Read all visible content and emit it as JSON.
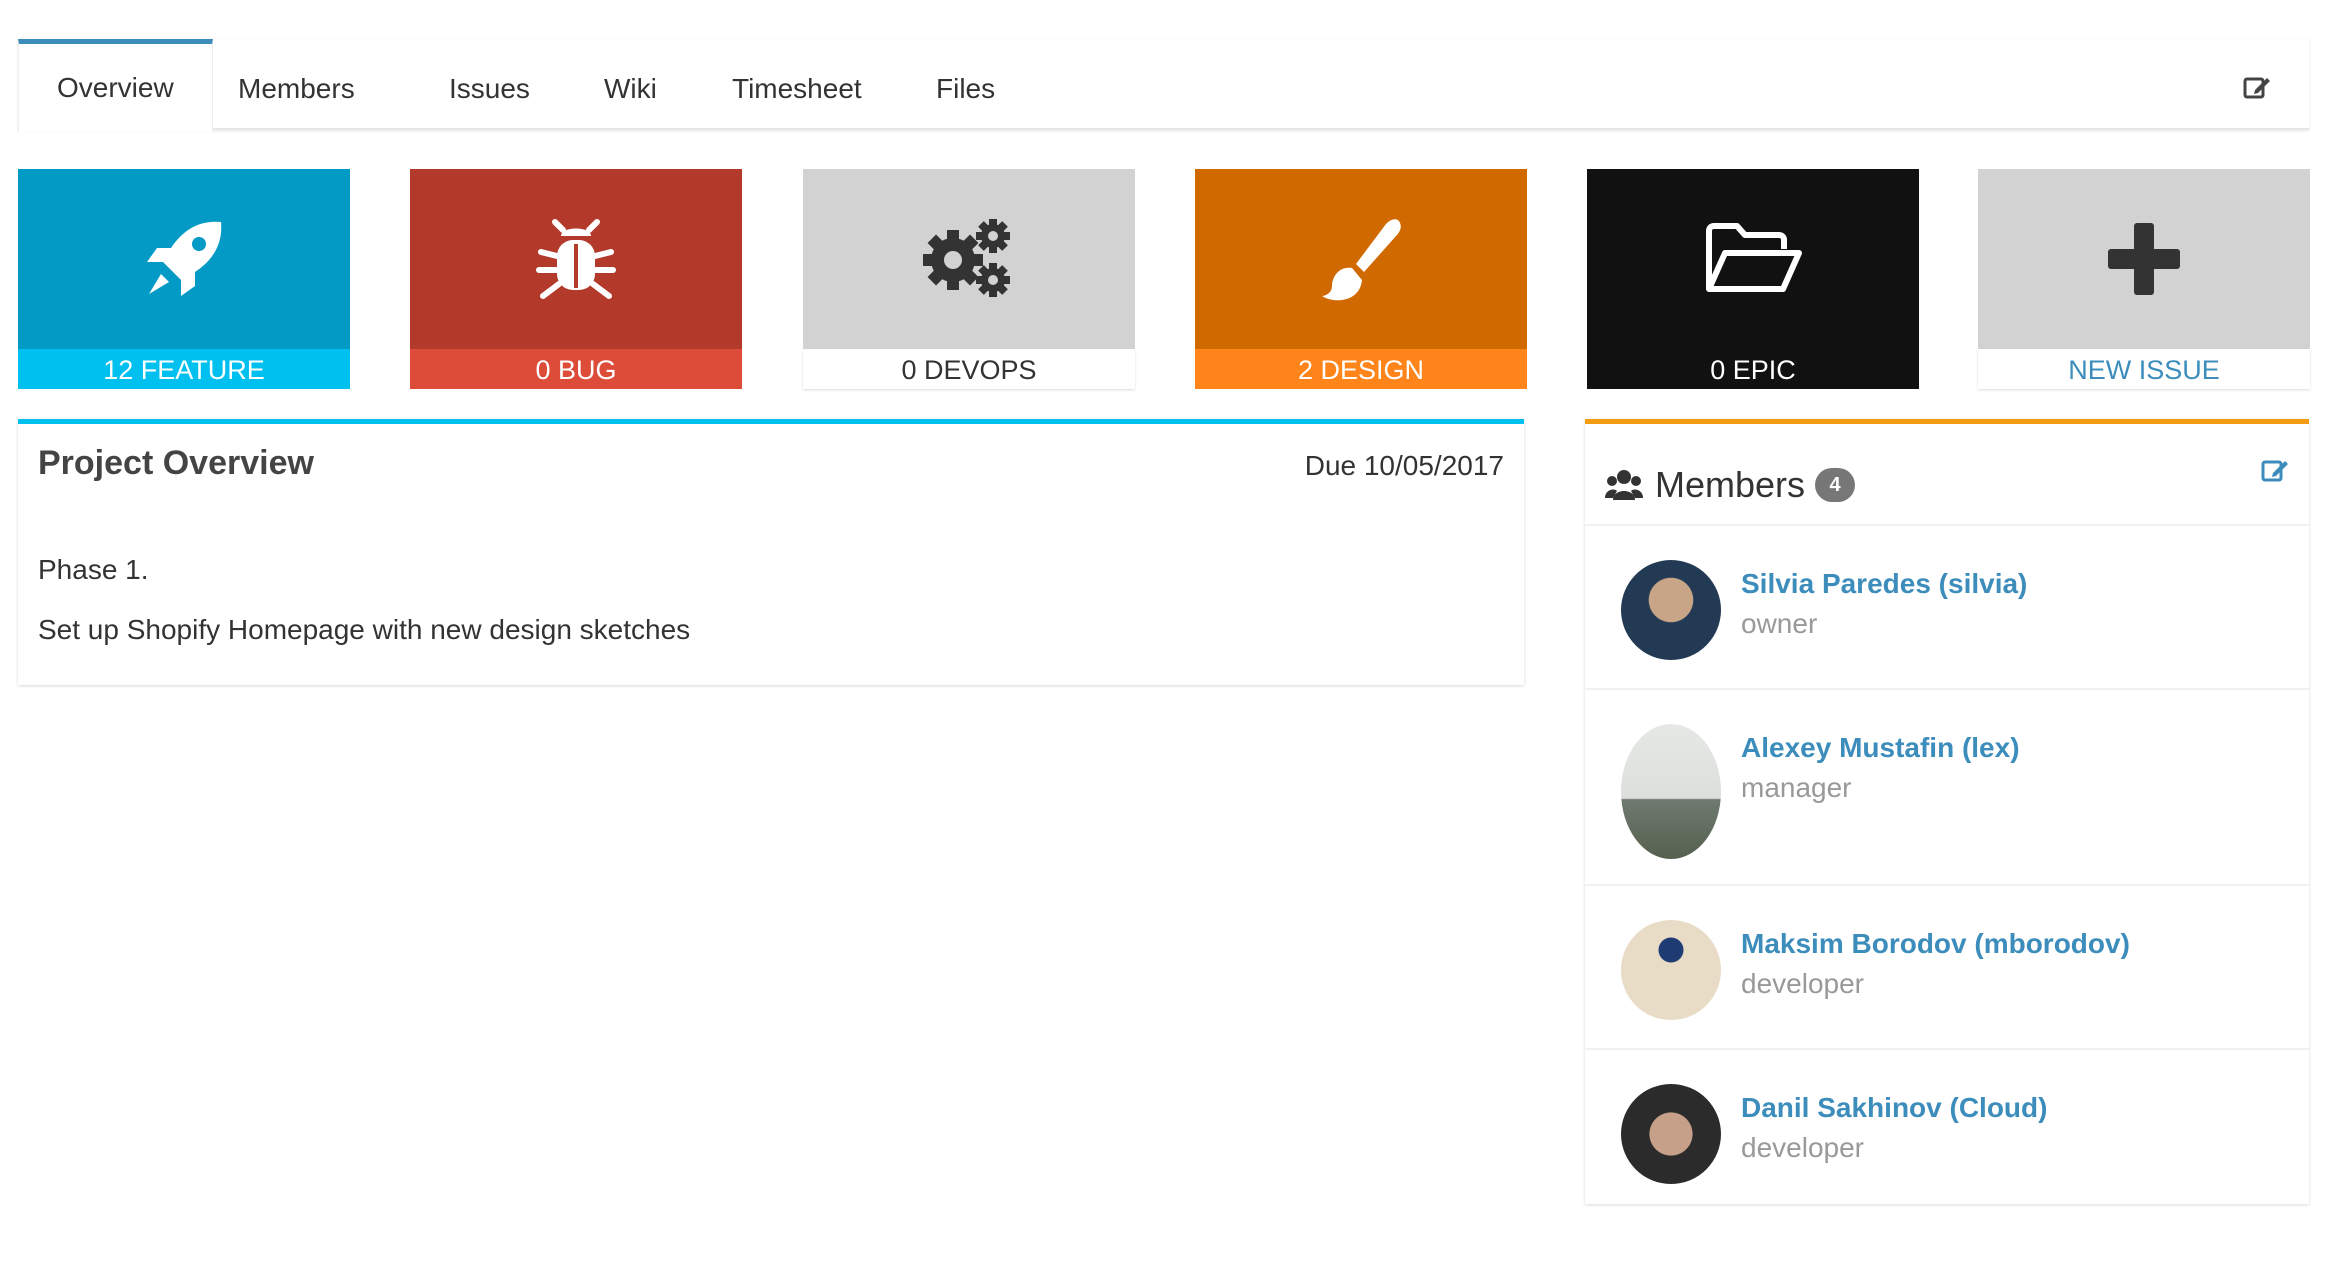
{
  "tabs": {
    "items": [
      {
        "label": "Overview"
      },
      {
        "label": "Members"
      },
      {
        "label": "Issues"
      },
      {
        "label": "Wiki"
      },
      {
        "label": "Timesheet"
      },
      {
        "label": "Files"
      }
    ],
    "active": "Overview",
    "edit_icon": "edit-icon"
  },
  "tiles": [
    {
      "label": "12 FEATURE",
      "icon": "rocket-icon",
      "top_color": "#039bc6",
      "bottom_color": "#00c0ef"
    },
    {
      "label": "0 BUG",
      "icon": "bug-icon",
      "top_color": "#b33a2b",
      "bottom_color": "#dd4b39"
    },
    {
      "label": "0 DEVOPS",
      "icon": "gears-icon",
      "top_color": "#d2d2d2",
      "bottom_color": "#ffffff"
    },
    {
      "label": "2 DESIGN",
      "icon": "paintbrush-icon",
      "top_color": "#d06a00",
      "bottom_color": "#ff851b"
    },
    {
      "label": "0 EPIC",
      "icon": "folder-open-icon",
      "top_color": "#111111",
      "bottom_color": "#111111"
    },
    {
      "label": "NEW ISSUE",
      "icon": "plus-icon",
      "top_color": "#d2d2d2",
      "bottom_color": "#ffffff"
    }
  ],
  "overview": {
    "title": "Project Overview",
    "due": "Due 10/05/2017",
    "line1": "Phase 1.",
    "line2": "Set up Shopify Homepage with new design sketches"
  },
  "members": {
    "title": "Members",
    "count": "4",
    "list": [
      {
        "name": "Silvia Paredes (silvia)",
        "role": "owner"
      },
      {
        "name": "Alexey Mustafin (lex)",
        "role": "manager"
      },
      {
        "name": "Maksim Borodov (mborodov)",
        "role": "developer"
      },
      {
        "name": "Danil Sakhinov (Cloud)",
        "role": "developer"
      }
    ]
  }
}
